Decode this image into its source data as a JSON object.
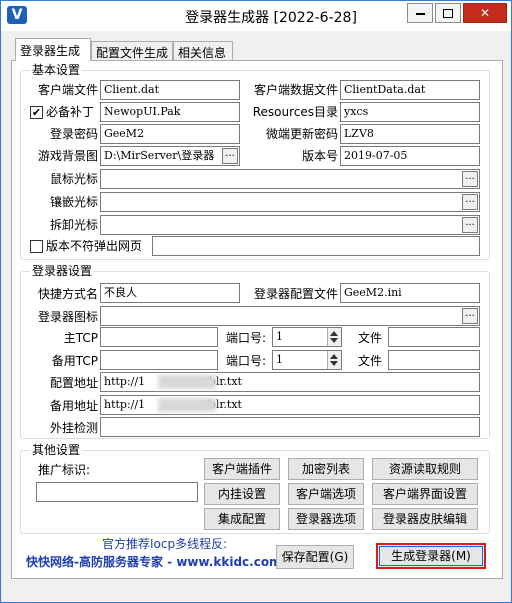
{
  "window": {
    "title": "登录器生成器 [2022-6-28]",
    "minimize": "▢",
    "maximize": "□",
    "close": "✕",
    "app_icon": "V"
  },
  "tabs": [
    "登录器生成",
    "配置文件生成",
    "相关信息"
  ],
  "basic": {
    "title": "基本设置",
    "client_file_label": "客户端文件",
    "client_file": "Client.dat",
    "client_data_label": "客户端数据文件",
    "client_data": "ClientData.dat",
    "patch_label": "必备补丁",
    "patch_checked": true,
    "patch": "NewopUI.Pak",
    "resources_label": "Resources目录",
    "resources": "yxcs",
    "password_label": "登录密码",
    "password": "GeeM2",
    "micro_password_label": "微端更新密码",
    "micro_password": "LZV8",
    "bg_label": "游戏背景图",
    "bg": "D:\\MirServer\\登录器",
    "version_label": "版本号",
    "version": "2019-07-05",
    "cursor_label": "鼠标光标",
    "cursor": "",
    "inlay_cursor_label": "镶嵌光标",
    "inlay_cursor": "",
    "remove_cursor_label": "拆卸光标",
    "remove_cursor": "",
    "mismatch_label": "版本不符弹出网页",
    "mismatch_checked": false,
    "mismatch_url": "",
    "browse": "..."
  },
  "launcher": {
    "title": "登录器设置",
    "shortcut_label": "快捷方式名",
    "shortcut": "不良人",
    "config_label": "登录器配置文件",
    "config": "GeeM2.ini",
    "icon_label": "登录器图标",
    "icon": "",
    "main_tcp_label": "主TCP",
    "main_tcp": "",
    "port_label": "端口号:",
    "main_port": "1",
    "file_label": "文件",
    "main_file": "",
    "backup_tcp_label": "备用TCP",
    "backup_tcp": "",
    "backup_port": "1",
    "backup_file": "",
    "config_url_label": "配置地址",
    "config_url_prefix": "http://1",
    "config_url_suffix": "/blr.txt",
    "backup_url_label": "备用地址",
    "backup_url_prefix": "http://1",
    "backup_url_suffix": "/blr.txt",
    "cheat_label": "外挂检测",
    "cheat": ""
  },
  "other": {
    "title": "其他设置",
    "promo_label": "推广标识:",
    "promo": "",
    "buttons": [
      "客户端插件",
      "加密列表",
      "资源读取规则",
      "内挂设置",
      "客户端选项",
      "客户端界面设置",
      "集成配置",
      "登录器选项",
      "登录器皮肤编辑"
    ]
  },
  "footer": {
    "recommend": "官方推荐Iocp多线程反:",
    "brand": "快快网络-高防服务器专家 - www.kkidc.com",
    "save": "保存配置(G)",
    "generate": "生成登录器(M)"
  },
  "colors": {
    "accent": "#0078d7",
    "promo_text": "#1f3fae",
    "highlight": "#e01919"
  }
}
